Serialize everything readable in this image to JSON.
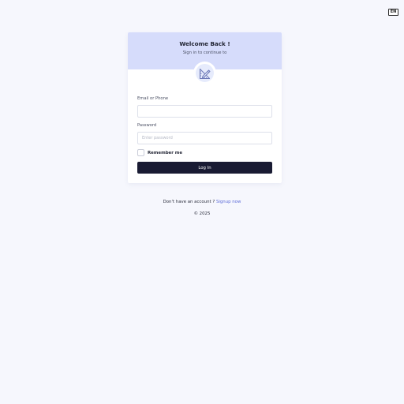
{
  "language_button": {
    "label": "EN"
  },
  "login_card": {
    "title": "Welcome Back !",
    "subtitle": "Sign in to continue to",
    "logo_icon": "ruler-pencil-icon",
    "email": {
      "label": "Email or Phone",
      "value": "",
      "placeholder": ""
    },
    "password": {
      "label": "Password",
      "value": "",
      "placeholder": "Enter password"
    },
    "remember_me": {
      "label": "Remember me",
      "checked": false
    },
    "submit_label": "Log In"
  },
  "footer": {
    "signup_prompt": "Don't have an account ?",
    "signup_link": "Signup now",
    "copyright": "© 2025"
  },
  "colors": {
    "page_background": "#f6f7fd",
    "header_background": "#d6dcfb",
    "button_background": "#191b33",
    "link": "#5b6ad8"
  }
}
